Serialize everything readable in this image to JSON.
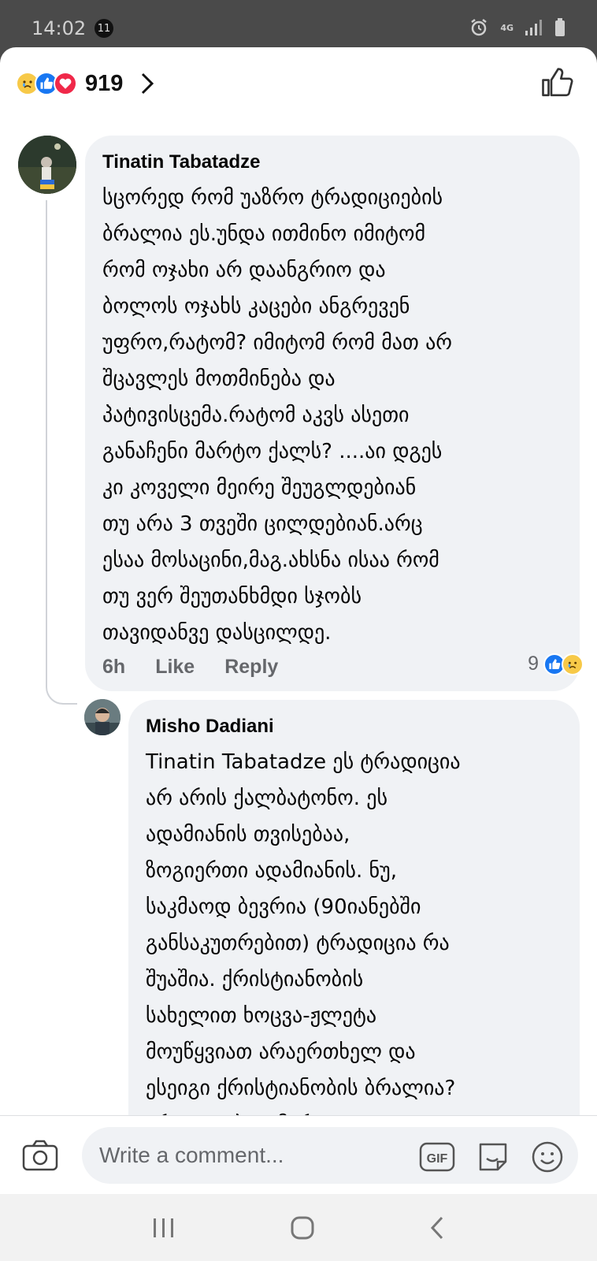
{
  "status_bar": {
    "time": "14:02",
    "notification_count": "11",
    "network": "4G"
  },
  "reactions": {
    "count": "919",
    "types": [
      "sad",
      "like",
      "love"
    ]
  },
  "comments": [
    {
      "author": "Tinatin Tabatadze",
      "text": "სცორედ რომ უაზრო ტრადიციების\nბრალია ეს.უნდა ითმინო იმიტომ\nრომ ოჯახი არ დაანგრიო და\nბოლოს ოჯახს კაცები ანგრევენ\nუფრო,რატომ? იმიტომ რომ მათ არ\nშცავლეს მოთმინება და\nპატივისცემა.რატომ აკვს ასეთი\nგანაჩენი მარტო ქალს? ....აი დგეს\nკი კოველი მეირე შეუგლდებიან\nთუ არა 3 თვეში ცილდებიან.არც\nესაა მოსაცინი,მაგ.ახსნა ისაა რომ\nთუ ვერ შეუთანხმდი სჯობს\nთავიდანვე დასცილდე.",
      "time": "6h",
      "like_label": "Like",
      "reply_label": "Reply",
      "reaction_count": "9",
      "reaction_types": [
        "like",
        "sad"
      ]
    },
    {
      "author": "Misho Dadiani",
      "text": "Tinatin Tabatadze ეს ტრადიცია\nარ არის ქალბატონო. ეს\nადამიანის თვისებაა,\nზოგიერთი ადამიანის. ნუ,\nსაკმაოდ ბევრია (90იანებში\nგანსაკუთრებით) ტრადიცია რა\nშუაშია. ქრისტიანობის\nსახელით ხოცვა-ჟლეტა\nმოუწყვიათ არაერთხელ და\nესეიგი ქრისტიანობის ბრალია?\nარა, ადიბიო მარტივი"
    }
  ],
  "composer": {
    "placeholder": "Write a comment..."
  },
  "colors": {
    "like_blue": "#1877f2",
    "love_red": "#f02849",
    "sad_yellow": "#f7c948",
    "bubble_bg": "#f0f2f5",
    "meta_gray": "#65676b"
  }
}
